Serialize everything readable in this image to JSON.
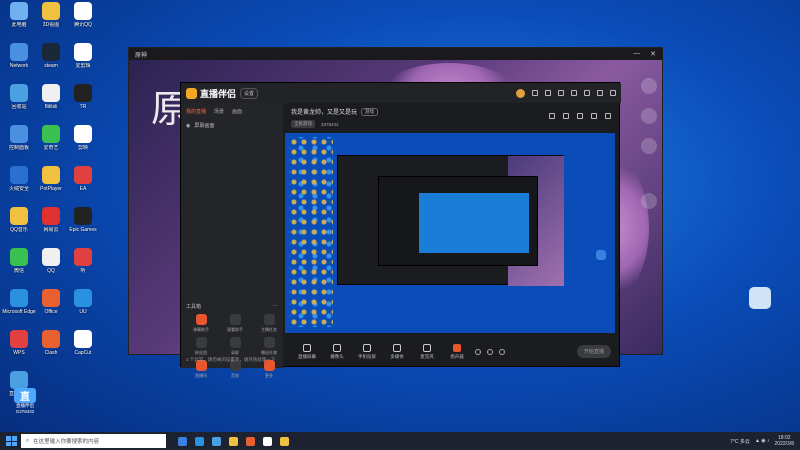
{
  "desktop_icons": [
    {
      "label": "此电脑",
      "color": "#6fb0f0"
    },
    {
      "label": "3D看图",
      "color": "#f0c040"
    },
    {
      "label": "腾讯QQ",
      "color": "#ffffff"
    },
    {
      "label": "Network",
      "color": "#4a90e0"
    },
    {
      "label": "steam",
      "color": "#1b2838"
    },
    {
      "label": "爱剪辑",
      "color": "#ffffff"
    },
    {
      "label": "回收站",
      "color": "#4aa0e0"
    },
    {
      "label": "Bilibili",
      "color": "#f0f0f0"
    },
    {
      "label": "TR",
      "color": "#222222"
    },
    {
      "label": "控制面板",
      "color": "#4a90e0"
    },
    {
      "label": "爱奇艺",
      "color": "#3ac050"
    },
    {
      "label": "剪映",
      "color": "#ffffff"
    },
    {
      "label": "火绒安全",
      "color": "#2a70d0"
    },
    {
      "label": "PotPlayer",
      "color": "#f0c040"
    },
    {
      "label": "EA",
      "color": "#e04040"
    },
    {
      "label": "QQ音乐",
      "color": "#f0c040"
    },
    {
      "label": "网易云",
      "color": "#e03030"
    },
    {
      "label": "Epic Games",
      "color": "#222222"
    },
    {
      "label": "微信",
      "color": "#3ac050"
    },
    {
      "label": "QQ",
      "color": "#f0f0f0"
    },
    {
      "label": "听",
      "color": "#e04040"
    },
    {
      "label": "Microsoft Edge",
      "color": "#2a90e0"
    },
    {
      "label": "Office",
      "color": "#e86030"
    },
    {
      "label": "UU",
      "color": "#2a90e0"
    },
    {
      "label": "WPS",
      "color": "#e04040"
    },
    {
      "label": "Clash",
      "color": "#e86030"
    },
    {
      "label": "CapCut",
      "color": "#ffffff"
    },
    {
      "label": "直播伴侣",
      "color": "#4aa0e0"
    }
  ],
  "outer_window": {
    "title": "原神",
    "art_text": "原"
  },
  "studio": {
    "app_name": "直播伴侣",
    "version_badge": "设置",
    "tabs": [
      "我的直播",
      "场景",
      "画面"
    ],
    "scene_name": "屏幕画面",
    "tools_title": "工具箱",
    "tools": [
      {
        "label": "弹幕助手",
        "accent": true
      },
      {
        "label": "观看助手",
        "accent": false
      },
      {
        "label": "主播任务",
        "accent": false
      },
      {
        "label": "粉丝团",
        "accent": false
      },
      {
        "label": "录屏",
        "accent": false
      },
      {
        "label": "赠送礼物",
        "accent": false
      },
      {
        "label": "直播间",
        "accent": true
      },
      {
        "label": "音效",
        "accent": false
      },
      {
        "label": "更多",
        "accent": true
      }
    ],
    "status_text": "1 个异常，请勿关闭设置项，请尽快处理一下",
    "room_title": "我是黄龙帅，又是又是玩",
    "room_tag": "游戏",
    "meta_category": "全民游戏",
    "meta_id": "3378432",
    "bottom_buttons": [
      {
        "label": "直播屏幕",
        "rec": false
      },
      {
        "label": "摄像头",
        "rec": false
      },
      {
        "label": "手机投屏",
        "rec": false
      },
      {
        "label": "多媒体",
        "rec": false
      },
      {
        "label": "麦克风",
        "rec": false
      },
      {
        "label": "扬声器",
        "rec": true
      }
    ],
    "start_live": "开始直播"
  },
  "badge": {
    "logo": "直",
    "name": "直播伴侣",
    "sub": "G378432"
  },
  "taskbar": {
    "search_placeholder": "在这里输入你要搜索的内容",
    "apps": [
      "#3a80e0",
      "#2a90e0",
      "#4aa0e0",
      "#f0c040",
      "#e86030",
      "#ffffff",
      "#f0c040"
    ],
    "weather": "7°C 多云",
    "time": "18:02",
    "date": "2022/3/8"
  }
}
